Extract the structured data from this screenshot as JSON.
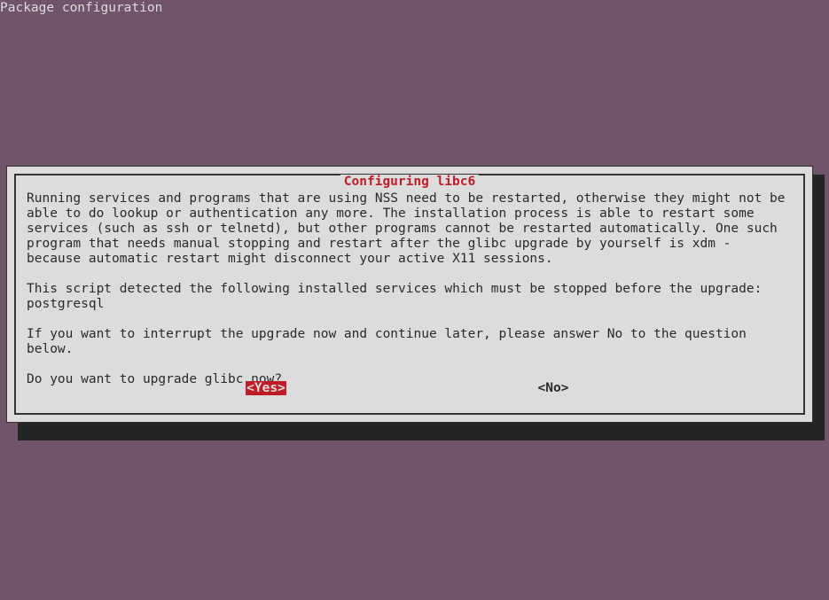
{
  "header": {
    "title": "Package configuration"
  },
  "dialog": {
    "title": " Configuring libc6 ",
    "paragraph1": "Running services and programs that are using NSS need to be restarted, otherwise they might not be able to do lookup or authentication any more. The installation process is able to restart some services (such as ssh or telnetd), but other programs cannot be restarted automatically. One such program that needs manual stopping and restart after the glibc upgrade by yourself is xdm - because automatic restart might disconnect your active X11 sessions.",
    "paragraph2": "This script detected the following installed services which must be stopped before the upgrade: postgresql",
    "paragraph3": "If you want to interrupt the upgrade now and continue later, please answer No to the question below.",
    "paragraph4": "Do you want to upgrade glibc now?",
    "yes_label": "<Yes>",
    "no_label": "<No>"
  }
}
